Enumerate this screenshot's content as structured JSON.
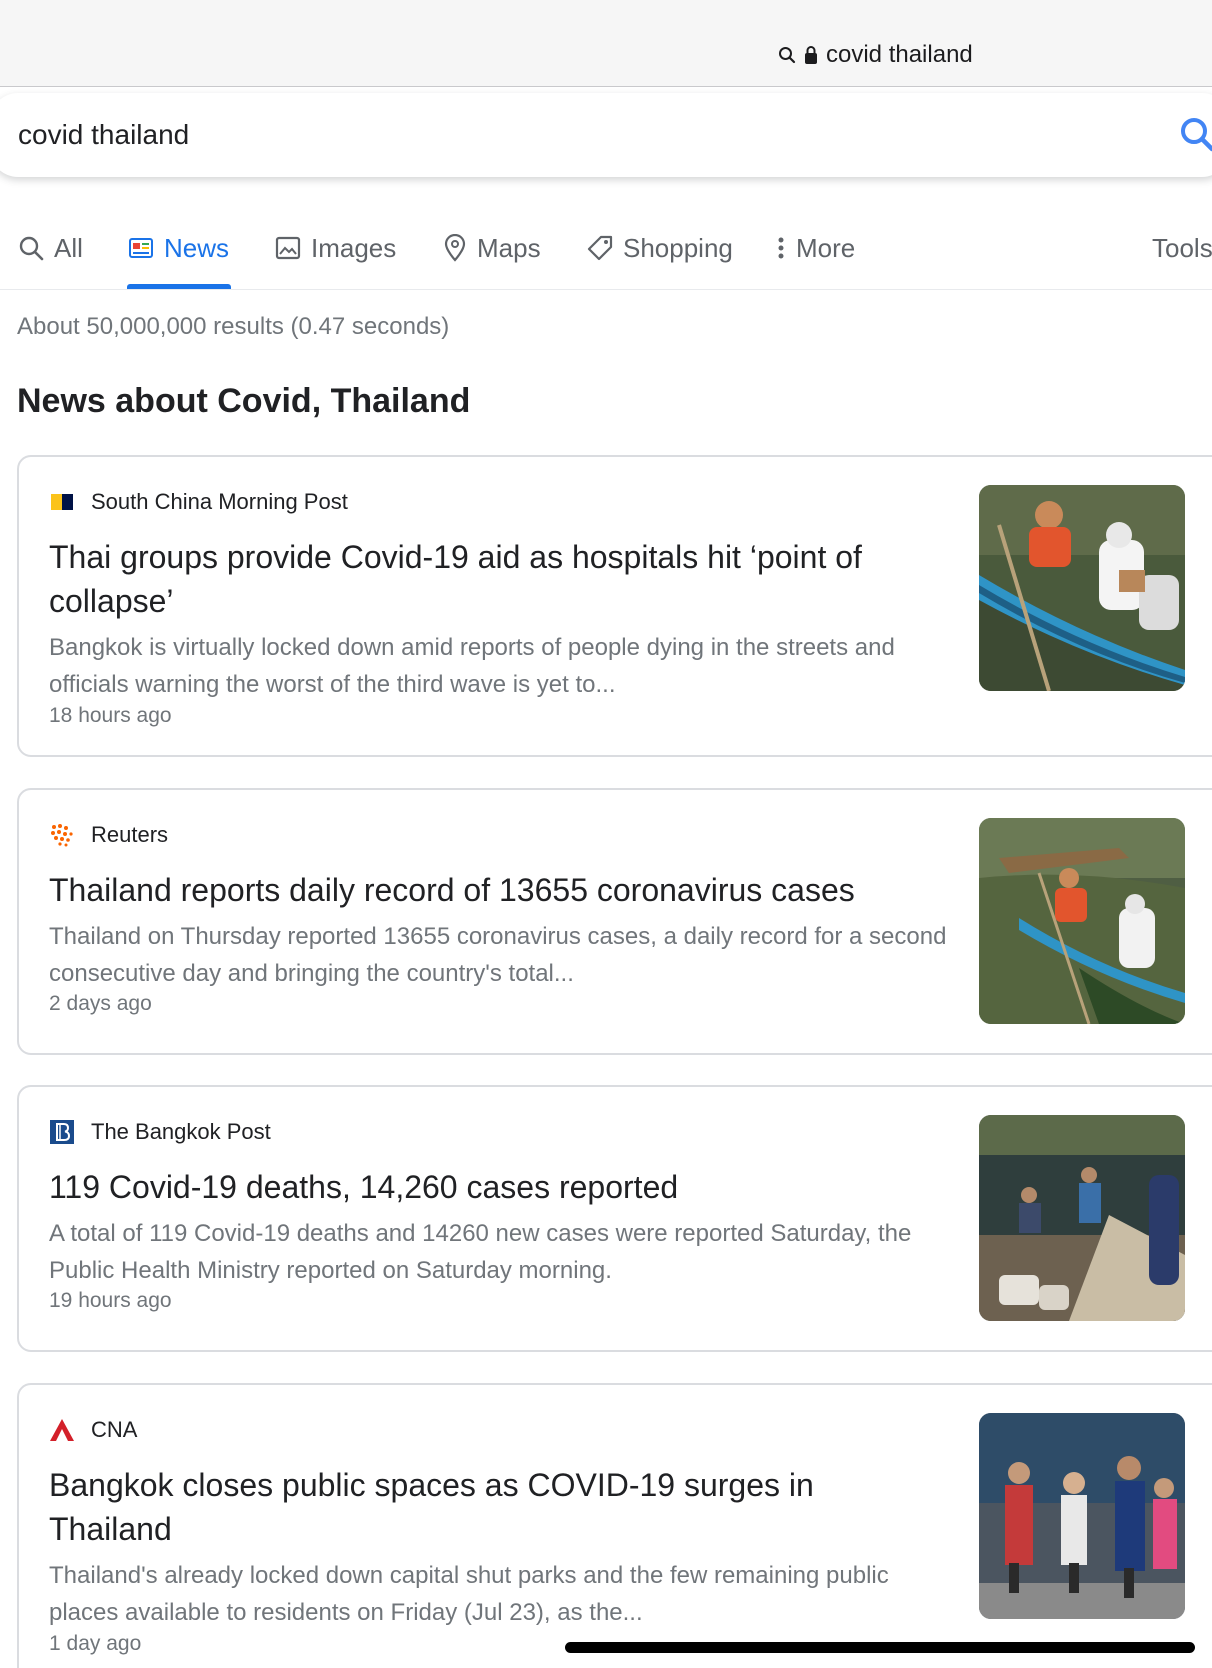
{
  "browser": {
    "url_text": "covid thailand",
    "icons": [
      "search-icon",
      "lock-icon"
    ]
  },
  "search": {
    "query": "covid thailand",
    "button_icon": "search-icon"
  },
  "tabs": [
    {
      "label": "All",
      "icon": "search-icon",
      "active": false
    },
    {
      "label": "News",
      "icon": "news-icon",
      "active": true
    },
    {
      "label": "Images",
      "icon": "image-icon",
      "active": false
    },
    {
      "label": "Maps",
      "icon": "map-pin-icon",
      "active": false
    },
    {
      "label": "Shopping",
      "icon": "tag-icon",
      "active": false
    },
    {
      "label": "More",
      "icon": "more-vertical-icon",
      "active": false
    }
  ],
  "tools_label": "Tools",
  "result_stats": "About 50,000,000 results (0.47 seconds)",
  "section_title": "News about Covid, Thailand",
  "colors": {
    "accent": "#1a73e8",
    "text_primary": "#202124",
    "text_secondary": "#70757a"
  },
  "articles": [
    {
      "source": "South China Morning Post",
      "headline": "Thai groups provide Covid-19 aid as hospitals hit ‘point of collapse’",
      "snippet": "Bangkok is virtually locked down amid reports of people dying in the streets and officials warning the worst of the third wave is yet to...",
      "time": "18 hours ago"
    },
    {
      "source": "Reuters",
      "headline": "Thailand reports daily record of 13655 coronavirus cases",
      "snippet": "Thailand on Thursday reported 13655 coronavirus cases, a daily record for a second consecutive day and bringing the country's total...",
      "time": "2 days ago"
    },
    {
      "source": "The Bangkok Post",
      "headline": "119 Covid-19 deaths, 14,260 cases reported",
      "snippet": "A total of 119 Covid-19 deaths and 14260 new cases were reported Saturday, the Public Health Ministry reported on Saturday morning.",
      "time": "19 hours ago"
    },
    {
      "source": "CNA",
      "headline": "Bangkok closes public spaces as COVID-19 surges in Thailand",
      "snippet": "Thailand's already locked down capital shut parks and the few remaining public places available to residents on Friday (Jul 23), as the...",
      "time": "1 day ago"
    }
  ]
}
